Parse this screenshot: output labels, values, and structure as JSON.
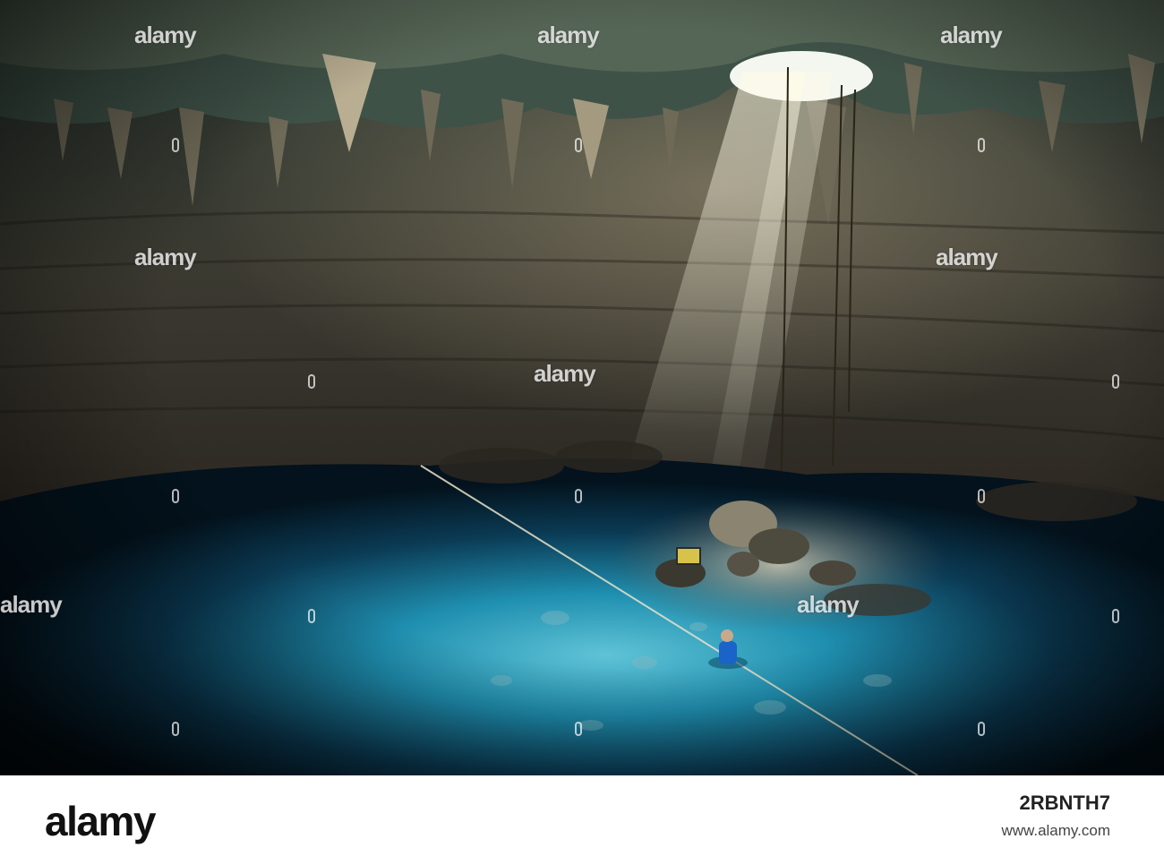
{
  "watermark": {
    "text": "alamy"
  },
  "footer": {
    "brand": "alamy",
    "image_id": "2RBNTH7",
    "site": "www.alamy.com"
  },
  "colors": {
    "water": "#1f8fb0",
    "rock": "#3b3a31",
    "light": "#e8e2c8",
    "swimmer": "#1a63c8"
  }
}
